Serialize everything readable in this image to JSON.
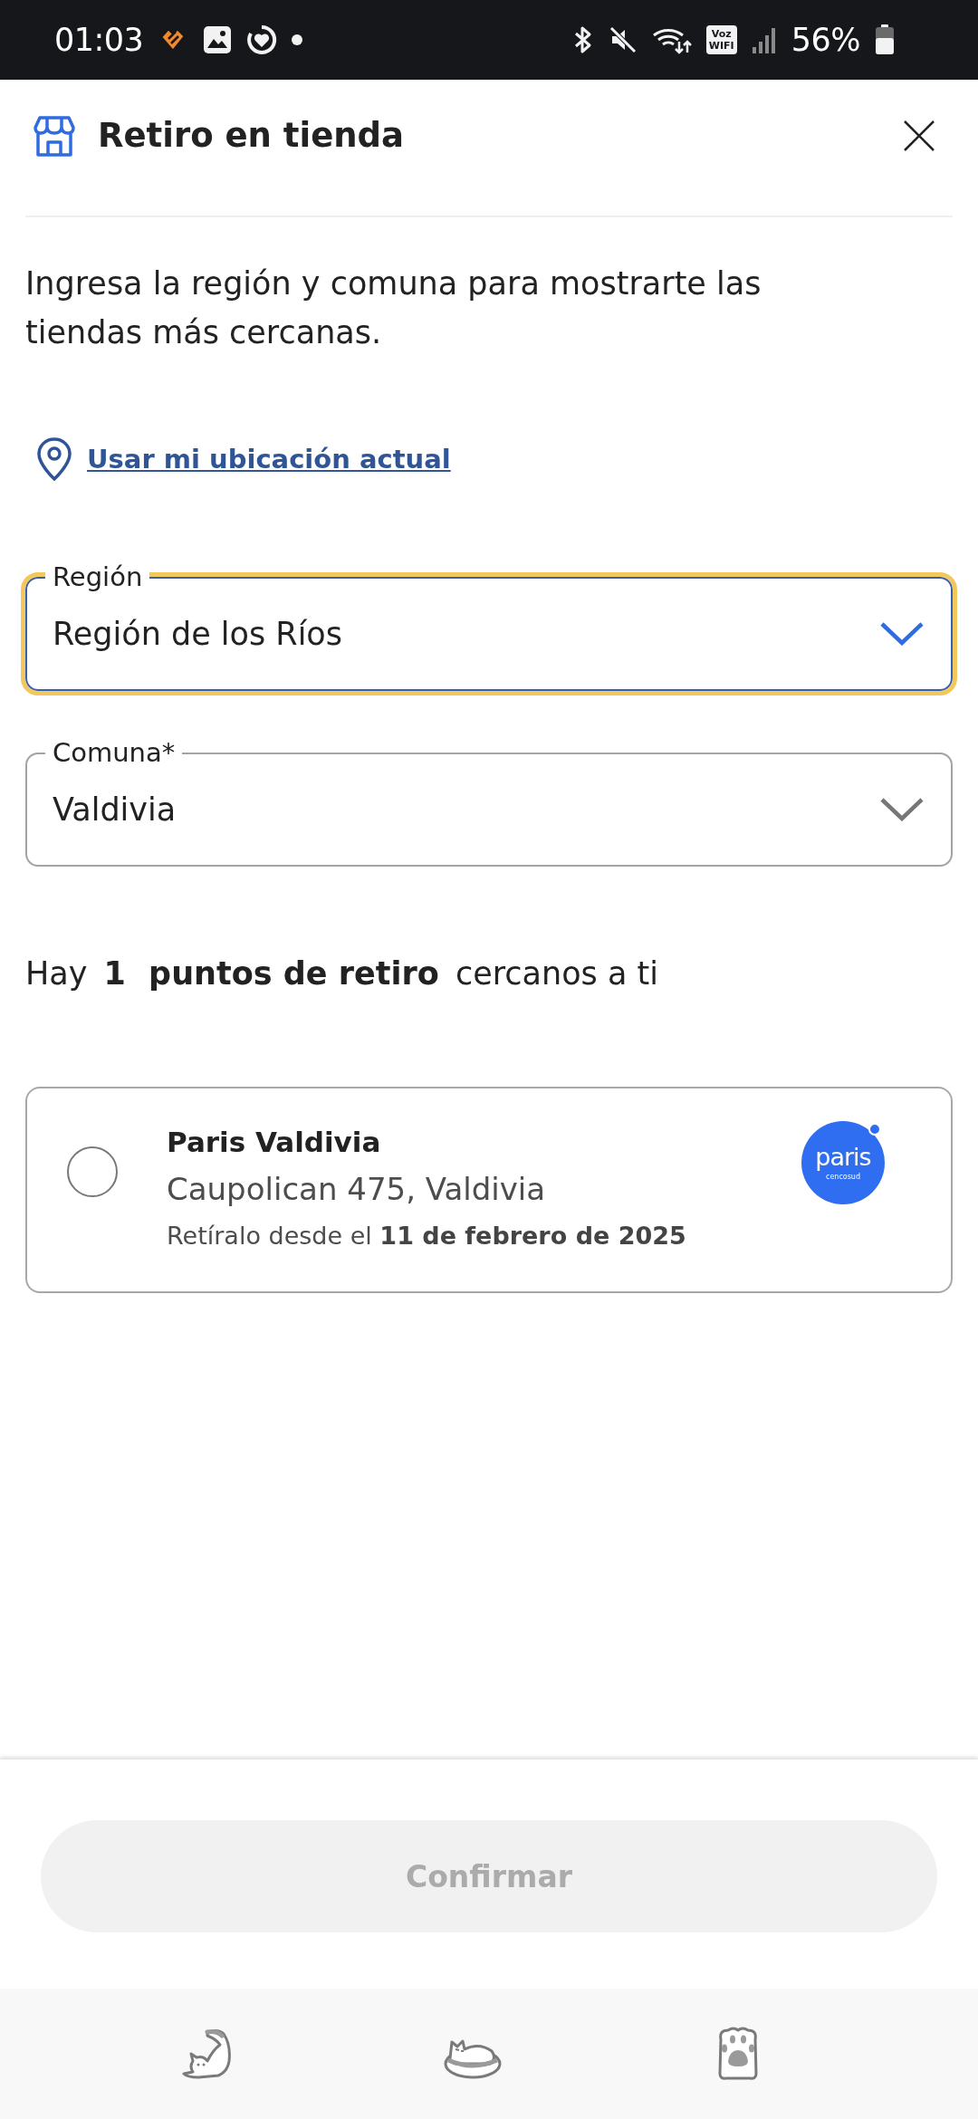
{
  "status_bar": {
    "time": "01:03",
    "calling_badge": [
      "Voz",
      "WIFI"
    ],
    "battery": "56%"
  },
  "header": {
    "title": "Retiro en tienda"
  },
  "intro": "Ingresa la región y comuna para mostrarte las tiendas más cercanas.",
  "location_link": "Usar mi ubicación actual",
  "fields": [
    {
      "label": "Región",
      "value": "Región de los Ríos",
      "focused": true
    },
    {
      "label": "Comuna*",
      "value": "Valdivia",
      "focused": false
    }
  ],
  "results_summary": "Hay **1** **puntos de retiro** cercanos a ti",
  "stores": [
    {
      "name": "Paris Valdivia",
      "address": "Caupolican 475, Valdivia",
      "pickup": "Retíralo desde el **11 de febrero de 2025**",
      "selected": false,
      "logo": {
        "wordmark": "paris",
        "subtitle": "cencosud"
      }
    }
  ],
  "confirm_button": {
    "label": "Confirmar",
    "disabled": true
  }
}
